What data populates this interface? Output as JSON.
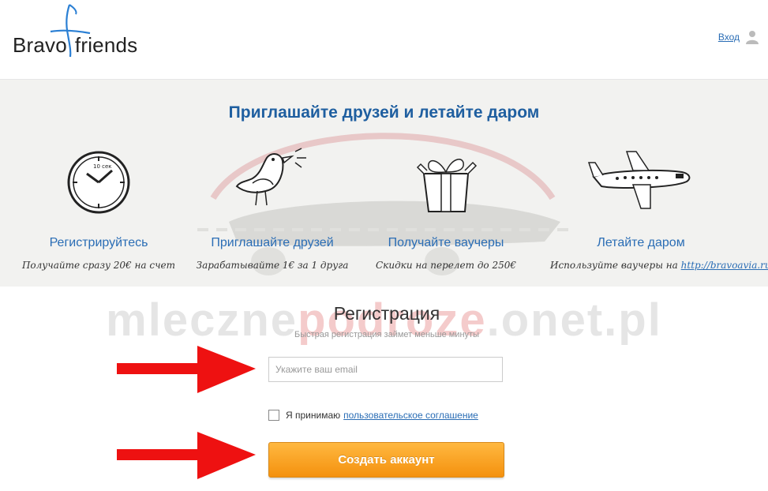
{
  "header": {
    "logo": {
      "word1": "Bravo",
      "word2": "friends"
    },
    "login_label": "Вход"
  },
  "banner": {
    "title": "Приглашайте друзей и летайте даром",
    "steps": [
      {
        "icon": "clock-icon",
        "clock_text": "10 сек",
        "title": "Регистрируйтесь",
        "desc": "Получайте сразу 20€ на счет"
      },
      {
        "icon": "bird-icon",
        "title": "Приглашайте друзей",
        "desc": "Зарабатывайте 1€ за 1 друга"
      },
      {
        "icon": "gift-icon",
        "title": "Получайте ваучеры",
        "desc": "Скидки на перелет до 250€"
      },
      {
        "icon": "airplane-icon",
        "title": "Летайте даром",
        "desc": "Используйте ваучеры на",
        "link": "http://bravoavia.ru"
      }
    ]
  },
  "watermark": {
    "part1": "mleczne",
    "part2": "podroze",
    "part3": ".onet.pl"
  },
  "registration": {
    "title": "Регистрация",
    "subtitle": "Быстрая регистрация займет меньше минуты",
    "email_placeholder": "Укажите ваш email",
    "agree_text": "Я принимаю",
    "agree_link": "пользовательское соглашение",
    "submit_label": "Создать аккаунт"
  },
  "colors": {
    "accent": "#1f5fa0",
    "link": "#2a6db5",
    "button": "#f4910e",
    "arrow": "#ee1111"
  }
}
